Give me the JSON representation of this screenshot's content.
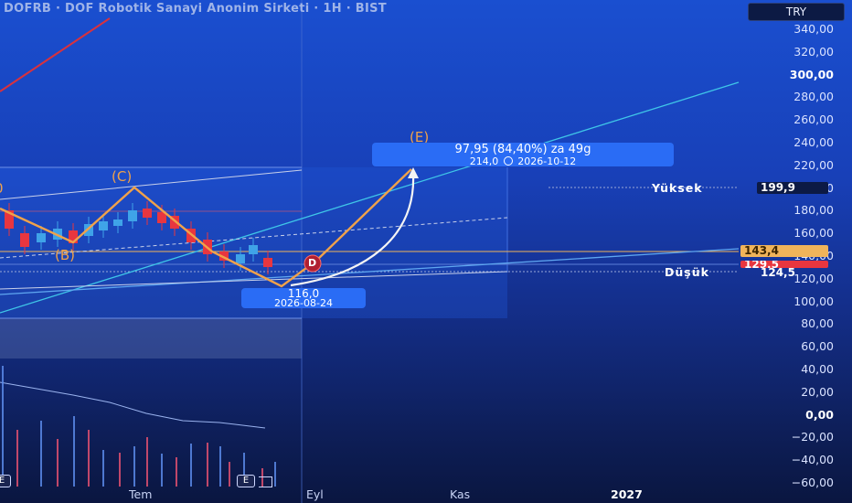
{
  "header": {
    "title": "DOFRB · DOF Robotik Sanayi Anonim Sirketi · 1H · BIST",
    "currency": "TRY"
  },
  "price_axis": {
    "labels": [
      "340,00",
      "320,00",
      "300,00",
      "280,00",
      "260,00",
      "240,00",
      "220,00",
      "200,00",
      "180,00",
      "160,00",
      "140,00",
      "120,00",
      "100,00",
      "80,00",
      "60,00",
      "40,00",
      "20,00",
      "0,00",
      "−20,00",
      "−40,00",
      "−60,00"
    ],
    "bold_labels": [
      "300,00",
      "0,00"
    ]
  },
  "time_axis": {
    "labels": [
      "Tem",
      "Eyl",
      "Kas",
      "2027"
    ],
    "bold_labels": [
      "2027"
    ]
  },
  "levels": {
    "high_label": "Yüksek",
    "high_value": "199,9",
    "low_label": "Düşük",
    "low_value": "124,5",
    "last_price": "143,4",
    "red_price": "129,5",
    "colors": {
      "last_price": "#f0b45a",
      "red_price": "#e8363f"
    }
  },
  "waves": {
    "b": "(B)",
    "c": "(C)",
    "d": "D",
    "e": "(E)",
    "partial_left": "0"
  },
  "tooltips": {
    "target": {
      "line1": "97,95 (84,40%) za 49g",
      "line2": "214,0",
      "line2_icon": "clock-icon",
      "line2_date": "2026-10-12"
    },
    "low_point": {
      "line1": "116,0",
      "line2": "2026-08-24"
    }
  },
  "markers": {
    "earnings": "E"
  },
  "colors": {
    "wave_line": "#f0a24a",
    "trend_line": "#3fc6e8",
    "candle_up": "#3fa3e8",
    "candle_down": "#e8363f",
    "accent": "#2a6cf5"
  }
}
